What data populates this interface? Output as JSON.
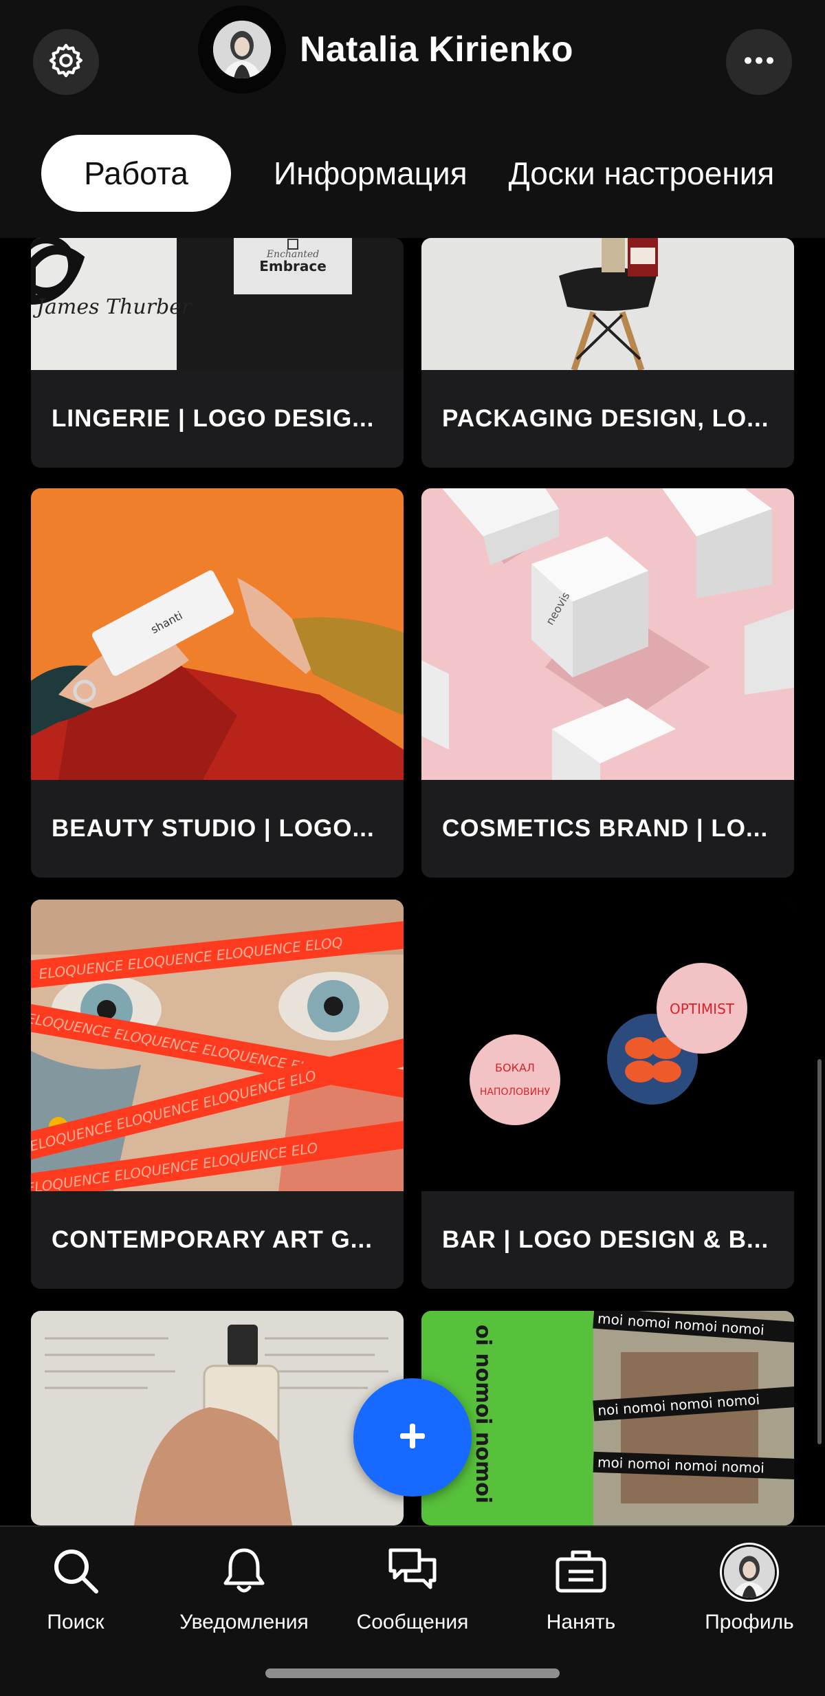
{
  "header": {
    "profile_name": "Natalia Kirienko",
    "settings_icon": "gear-icon",
    "more_icon": "more-horizontal-icon"
  },
  "tabs": [
    {
      "label": "Работа",
      "active": true
    },
    {
      "label": "Информация",
      "active": false
    },
    {
      "label": "Доски настроения",
      "active": false
    }
  ],
  "projects": [
    {
      "title": "LINGERIE | LOGO DESIG..."
    },
    {
      "title": "PACKAGING DESIGN, LO..."
    },
    {
      "title": "BEAUTY STUDIO | LOGO..."
    },
    {
      "title": "COSMETICS BRAND | LO..."
    },
    {
      "title": "CONTEMPORARY ART G..."
    },
    {
      "title": "BAR | LOGO DESIGN & B..."
    },
    {
      "title": ""
    },
    {
      "title": ""
    }
  ],
  "fab": {
    "icon": "plus-icon"
  },
  "bottom_nav": [
    {
      "label": "Поиск",
      "icon": "search-icon"
    },
    {
      "label": "Уведомления",
      "icon": "bell-icon"
    },
    {
      "label": "Сообщения",
      "icon": "chat-icon"
    },
    {
      "label": "Нанять",
      "icon": "briefcase-icon"
    },
    {
      "label": "Профиль",
      "icon": "avatar"
    }
  ],
  "colors": {
    "background": "#000000",
    "header": "#111111",
    "card": "#1c1c1e",
    "accent_blue": "#1769ff"
  }
}
